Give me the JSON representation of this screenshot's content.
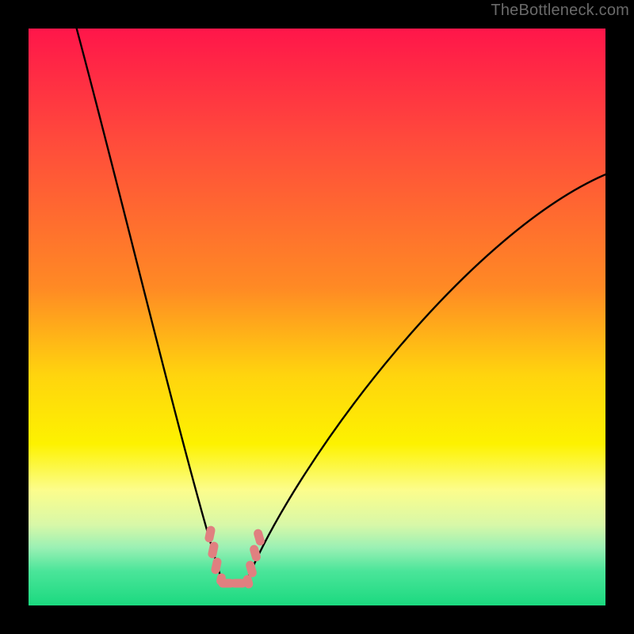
{
  "watermark": {
    "text": "TheBottleneck.com"
  },
  "colors": {
    "frame": "#000000",
    "curve": "#000000",
    "marker": "#e08080",
    "gradient_stops": [
      "#ff164a",
      "#ff4c3b",
      "#ff8a24",
      "#ffd40e",
      "#fdf200",
      "#fcfd8c",
      "#d8f8a8",
      "#9af0b4",
      "#4be59a",
      "#1bd97f"
    ]
  },
  "chart_data": {
    "type": "line",
    "title": "",
    "xlabel": "",
    "ylabel": "",
    "xlim": [
      0,
      100
    ],
    "ylim": [
      0,
      100
    ],
    "left_curve_anchors": [
      {
        "x": 8,
        "y": 100
      },
      {
        "x": 33,
        "y": 4
      }
    ],
    "right_curve_anchors": [
      {
        "x": 37,
        "y": 4
      },
      {
        "x": 100,
        "y": 75
      }
    ],
    "valley_markers": [
      {
        "x": 31,
        "y": 13
      },
      {
        "x": 31.5,
        "y": 10
      },
      {
        "x": 32,
        "y": 7
      },
      {
        "x": 33,
        "y": 4
      },
      {
        "x": 34,
        "y": 4
      },
      {
        "x": 35.5,
        "y": 4
      },
      {
        "x": 37,
        "y": 4
      },
      {
        "x": 37.5,
        "y": 5.5
      },
      {
        "x": 38,
        "y": 7.5
      },
      {
        "x": 38.5,
        "y": 10
      },
      {
        "x": 39,
        "y": 12.5
      }
    ]
  }
}
